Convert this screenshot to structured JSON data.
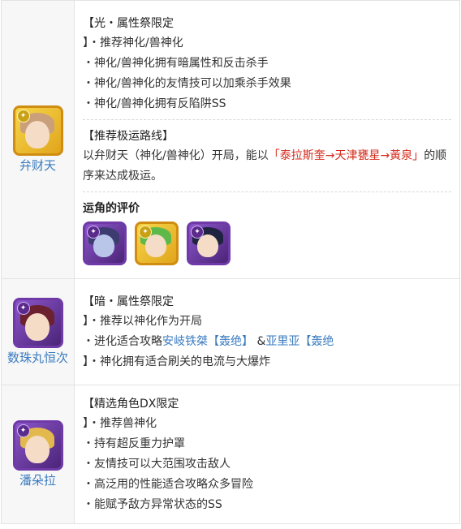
{
  "rows": [
    {
      "name": "弁财天",
      "attribute": "light",
      "heading": "【光・属性祭限定",
      "lines": [
        "】・推荐神化/兽神化",
        "・神化/兽神化拥有暗属性和反击杀手",
        "・神化/兽神化的友情技可以加乘杀手效果",
        "・神化/兽神化拥有反陷阱SS"
      ],
      "route_title": "【推荐极运路线】",
      "route_pre": "以弁财天（神化/兽神化）开局，能以",
      "route_highlight": "「泰拉斯奎→天津甕星→黃泉」",
      "route_post": "的顺序来达成极运。",
      "eval_title": "运角的评价",
      "eval_icons": [
        "dark-dragon-portrait-icon",
        "green-hair-girl-portrait-icon",
        "dark-swordsman-portrait-icon"
      ]
    },
    {
      "name": "数珠丸恒次",
      "attribute": "dark",
      "heading": "【暗・属性祭限定",
      "line1": "】・推荐以神化作为开局",
      "line2_pre": "・进化适合攻略",
      "line2_link1": "安岐铁桀【轰绝】",
      "line2_mid": "&",
      "line2_link2": "亚里亚【轰绝",
      "line3": "】・神化拥有适合刷关的电流与大爆炸"
    },
    {
      "name": "潘朵拉",
      "attribute": "dark",
      "heading": "【精选角色DX限定",
      "lines": [
        "】・推荐兽神化",
        "・持有超反重力护罩",
        "・友情技可以大范围攻击敌人",
        "・高泛用的性能适合攻略众多冒险",
        "・能赋予敌方异常状态的SS"
      ]
    }
  ]
}
